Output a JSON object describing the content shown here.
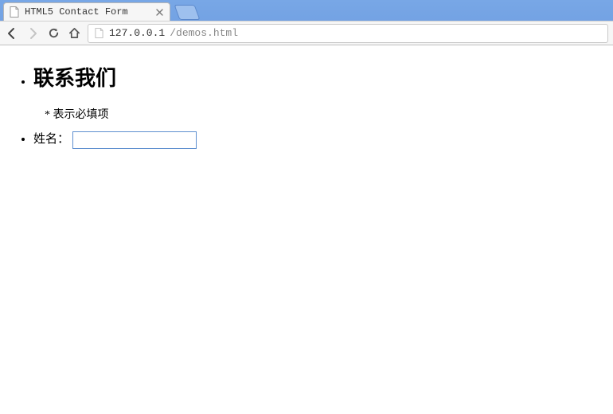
{
  "browser": {
    "tab_title": "HTML5 Contact Form",
    "url_host": "127.0.0.1",
    "url_path": "/demos.html"
  },
  "page": {
    "heading": "联系我们",
    "required_marker": "*",
    "required_note": "表示必填项",
    "name_label": "姓名：",
    "name_value": ""
  }
}
